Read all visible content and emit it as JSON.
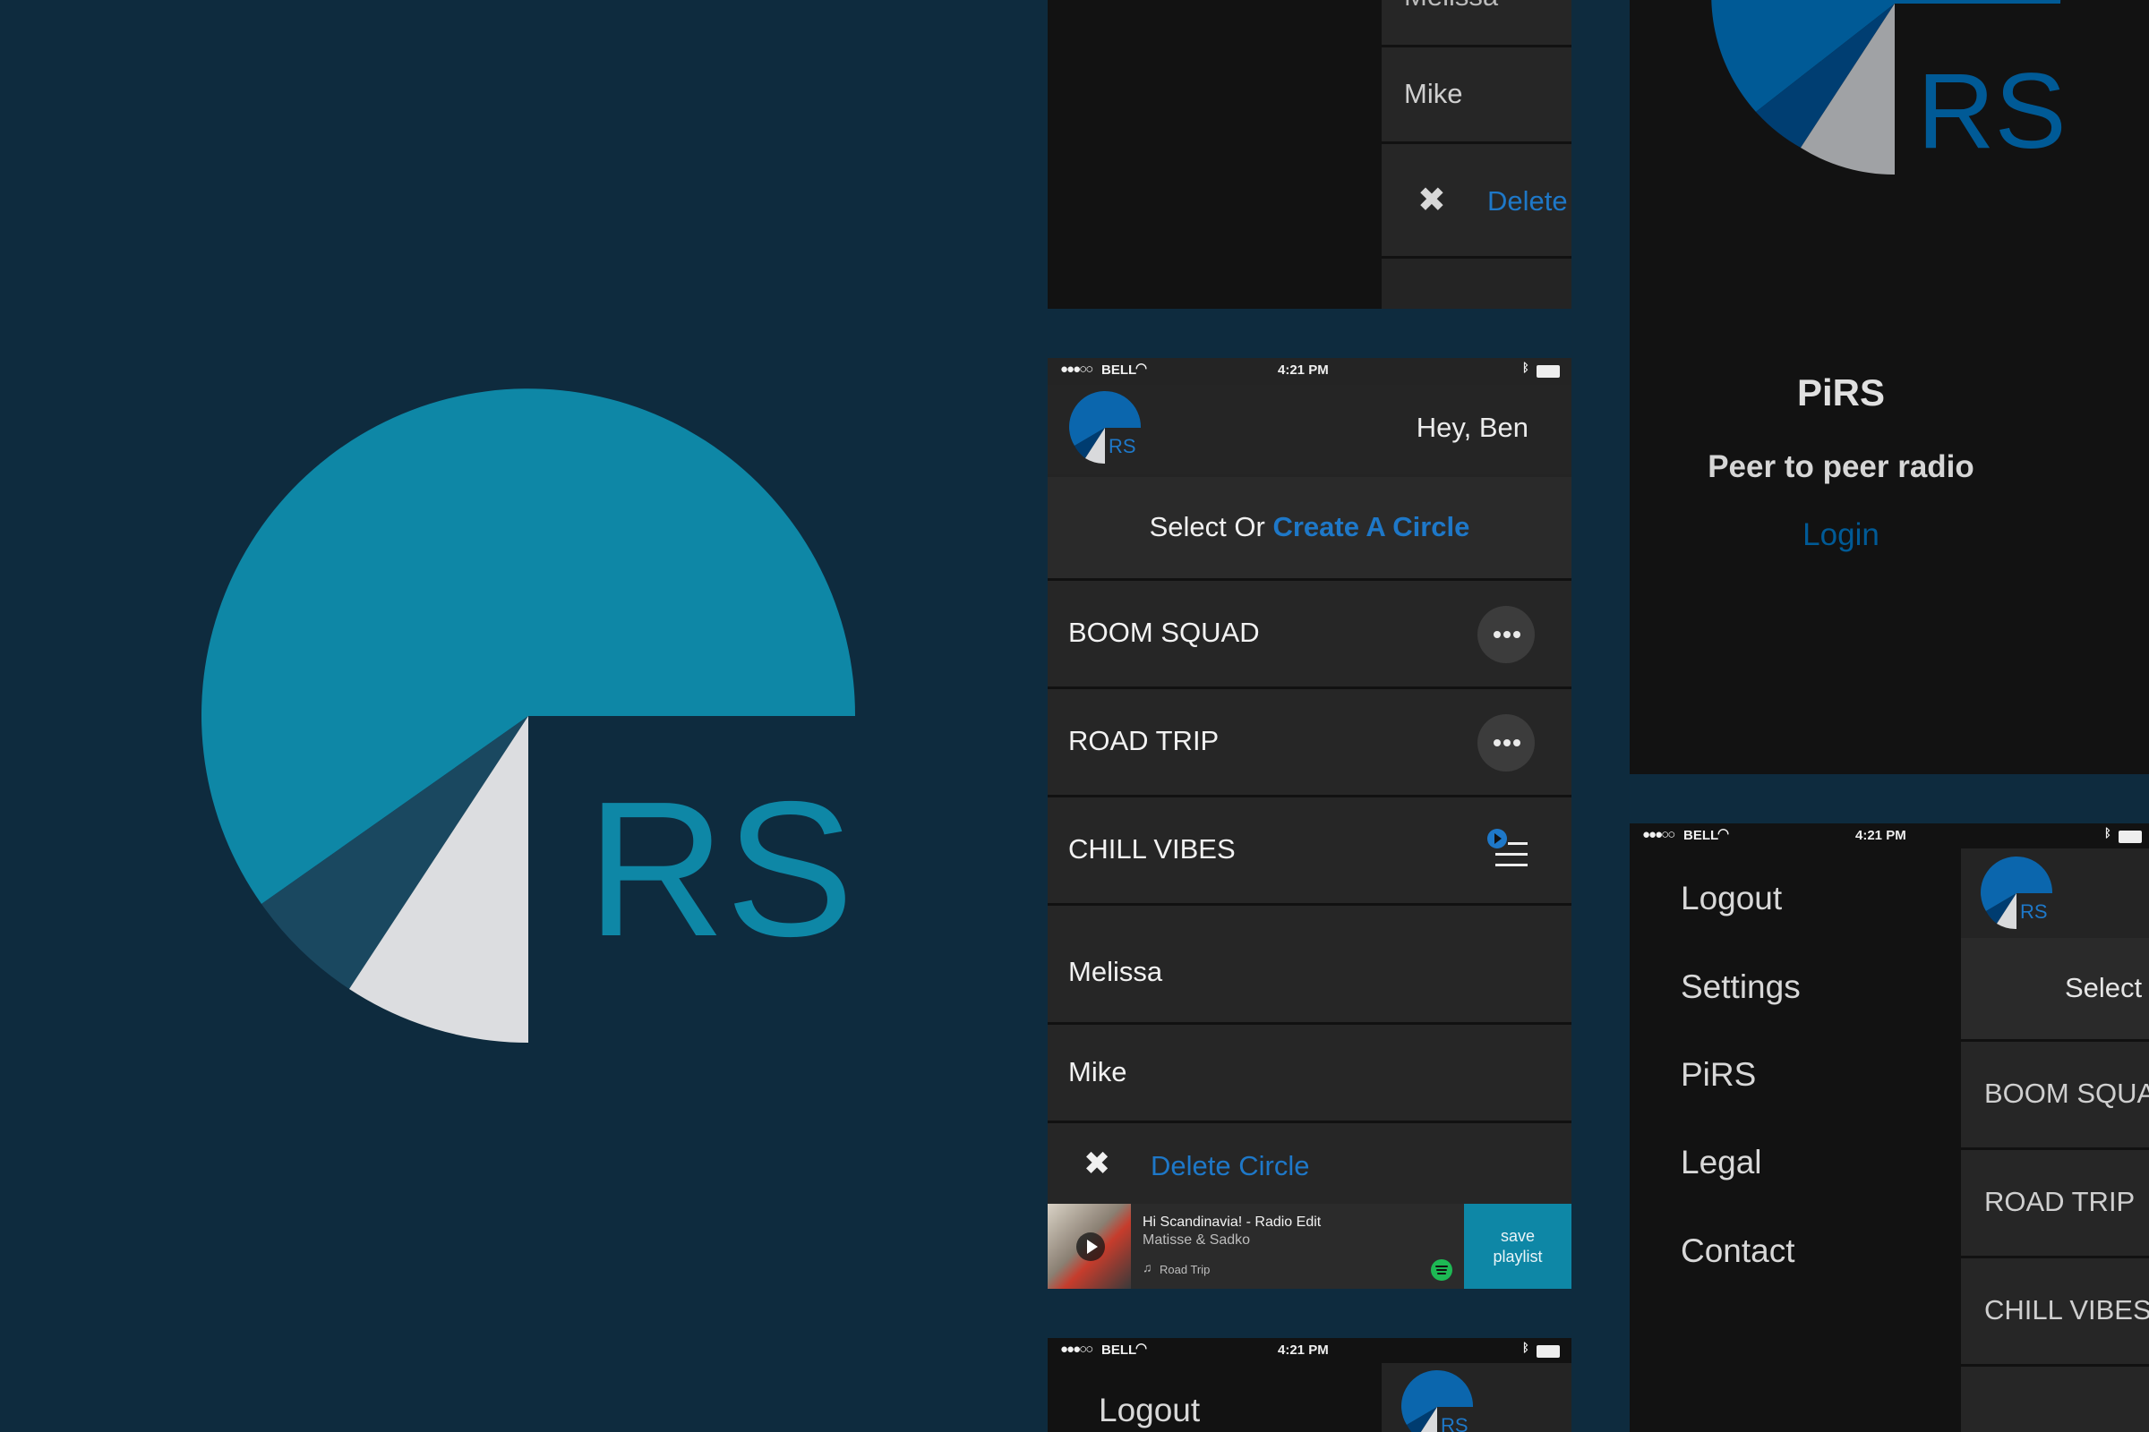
{
  "logo": {
    "letters": "RS"
  },
  "status_bar": {
    "carrier": "BELL",
    "time": "4:21 PM"
  },
  "top_fragment": {
    "partial_name": "Melissa",
    "name": "Mike",
    "delete_label": "Delete"
  },
  "main_screen": {
    "greeting": "Hey, Ben",
    "select_text": "Select Or",
    "create_link": "Create A Circle",
    "circles": [
      {
        "name": "BOOM SQUAD",
        "action": "more-options"
      },
      {
        "name": "ROAD TRIP",
        "action": "more-options"
      },
      {
        "name": "CHILL VIBES",
        "action": "now-playing"
      }
    ],
    "members": [
      "Melissa",
      "Mike"
    ],
    "delete_label": "Delete Circle",
    "now_playing": {
      "track": "Hi Scandinavia! - Radio Edit",
      "artist": "Matisse & Sadko",
      "playlist": "Road Trip",
      "save_button": "save\nplaylist"
    }
  },
  "login_screen": {
    "app_name": "PiRS",
    "tagline": "Peer to peer radio",
    "login_link": "Login"
  },
  "side_menu": {
    "items": [
      "Logout",
      "Settings",
      "PiRS",
      "Legal",
      "Contact"
    ],
    "peek": {
      "select_text": "Select",
      "circles": [
        "BOOM SQUAD",
        "ROAD TRIP",
        "CHILL VIBES"
      ]
    }
  },
  "bottom_fragment": {
    "menu_item": "Logout"
  },
  "colors": {
    "background": "#0e2b3e",
    "teal": "#0e87a6",
    "blue": "#005a96",
    "link": "#1e78c8",
    "save": "#0e87a6"
  }
}
